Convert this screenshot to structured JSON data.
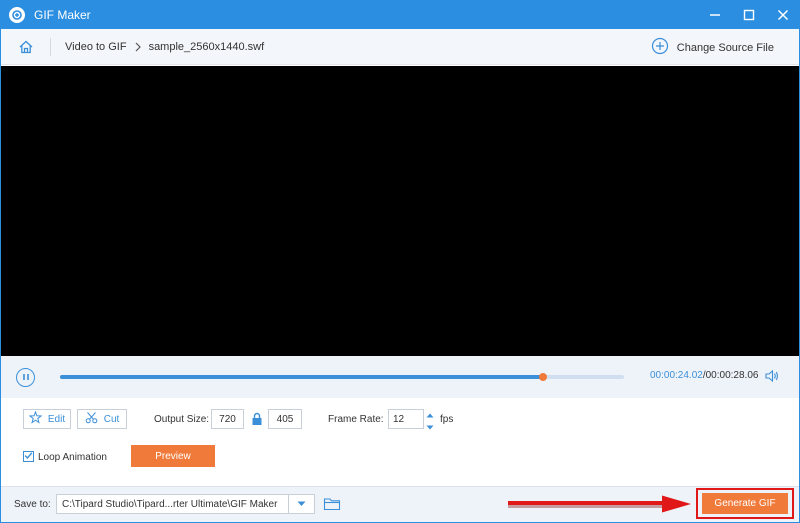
{
  "window": {
    "title": "GIF Maker"
  },
  "toolbar": {
    "breadcrumb": [
      "Video to GIF",
      "sample_2560x1440.swf"
    ],
    "change_source_label": "Change Source File"
  },
  "player": {
    "current_time": "00:00:24.02",
    "separator": "/",
    "duration": "00:00:28.06",
    "progress": 0.8557
  },
  "controls": {
    "edit_label": "Edit",
    "cut_label": "Cut",
    "output_size_label": "Output Size:",
    "width": "720",
    "height": "405",
    "frame_rate_label": "Frame Rate:",
    "frame_rate": "12",
    "fps_label": "fps",
    "loop_label": "Loop Animation",
    "loop_checked": true,
    "preview_label": "Preview"
  },
  "footer": {
    "save_to_label": "Save to:",
    "path": "C:\\Tipard Studio\\Tipard...rter Ultimate\\GIF Maker",
    "generate_label": "Generate GIF"
  },
  "colors": {
    "titlebar": "#2b8ee0",
    "accent": "#3b8fd9",
    "action": "#f07a3a",
    "highlight": "#e01818"
  },
  "icons": [
    "app-logo-icon",
    "minimize-icon",
    "maximize-icon",
    "close-icon",
    "home-icon",
    "chevron-right-icon",
    "plus-circle-icon",
    "pause-icon",
    "volume-icon",
    "edit-star-icon",
    "scissors-icon",
    "lock-icon",
    "spinner-up-icon",
    "spinner-down-icon",
    "check-icon",
    "dropdown-icon",
    "folder-icon",
    "red-arrow-icon"
  ]
}
